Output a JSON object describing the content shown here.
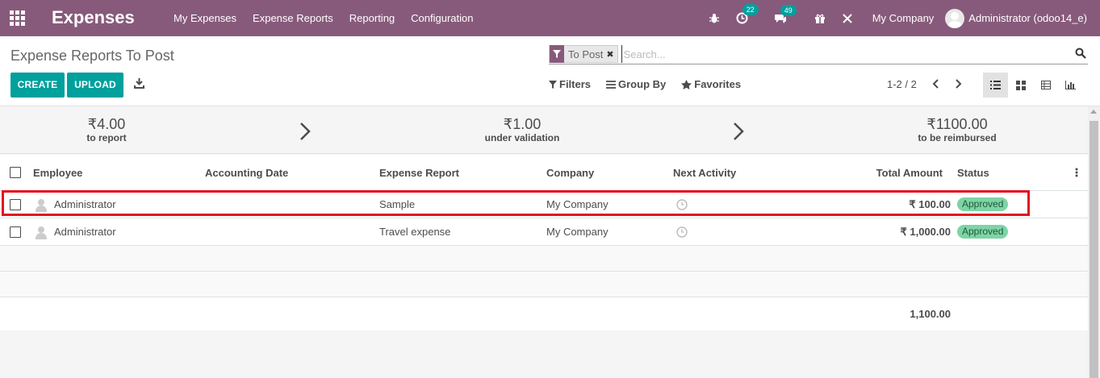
{
  "navbar": {
    "app_title": "Expenses",
    "menu": [
      "My Expenses",
      "Expense Reports",
      "Reporting",
      "Configuration"
    ],
    "activity_count": "22",
    "message_count": "49",
    "company": "My Company",
    "user": "Administrator (odoo14_e)"
  },
  "control_panel": {
    "breadcrumb": "Expense Reports To Post",
    "facet": "To Post",
    "search_placeholder": "Search...",
    "create_label": "CREATE",
    "upload_label": "UPLOAD",
    "filters_label": "Filters",
    "groupby_label": "Group By",
    "favorites_label": "Favorites",
    "pager": "1-2 / 2"
  },
  "stats": [
    {
      "amount": "₹4.00",
      "label": "to report"
    },
    {
      "amount": "₹1.00",
      "label": "under validation"
    },
    {
      "amount": "₹1100.00",
      "label": "to be reimbursed"
    }
  ],
  "list": {
    "columns": [
      "Employee",
      "Accounting Date",
      "Expense Report",
      "Company",
      "Next Activity",
      "Total Amount",
      "Status"
    ],
    "rows": [
      {
        "employee": "Administrator",
        "accounting_date": "",
        "report": "Sample",
        "company": "My Company",
        "amount": "₹ 100.00",
        "status": "Approved"
      },
      {
        "employee": "Administrator",
        "accounting_date": "",
        "report": "Travel expense",
        "company": "My Company",
        "amount": "₹ 1,000.00",
        "status": "Approved"
      }
    ],
    "total": "1,100.00"
  },
  "colors": {
    "brand": "#875a7b",
    "primary": "#00a09d",
    "status_approved": "#7dd4a6",
    "highlight": "#e3121e"
  }
}
